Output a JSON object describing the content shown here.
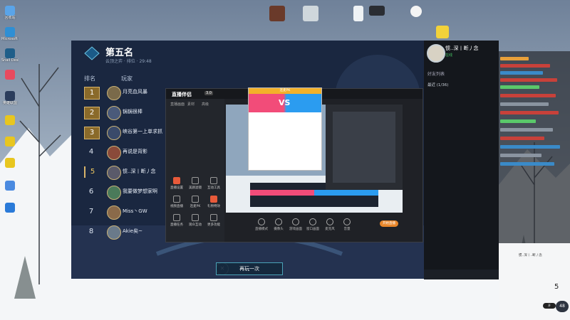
{
  "desktop": {
    "left_icons": [
      {
        "label": "回收站",
        "color": "#5aa4e8"
      },
      {
        "label": "Microsoft Edge",
        "color": "#2f8fd4"
      },
      {
        "label": "Snail Desktop",
        "color": "#1f5e89"
      },
      {
        "label": "",
        "color": "#e84a5f"
      },
      {
        "label": "英雄联盟",
        "color": "#2b3d5c"
      },
      {
        "label": "",
        "color": "#e8c61f"
      },
      {
        "label": "",
        "color": "#e8c61f"
      },
      {
        "label": "",
        "color": "#e8c61f"
      },
      {
        "label": "",
        "color": "#4a8ae0"
      },
      {
        "label": "",
        "color": "#2a7ad8"
      }
    ]
  },
  "game": {
    "title": "第五名",
    "subtitle": "云顶之弈 · 排位 · 29:48",
    "col_rank": "排名",
    "col_player": "玩家",
    "play_again": "再玩一次",
    "close_symbol": "✕",
    "rankings": [
      {
        "rank": "1",
        "name": "月亮血风暴",
        "medal": true,
        "self": false,
        "avatar": "#7a6a4a"
      },
      {
        "rank": "2",
        "name": "锅锅很棒",
        "medal": true,
        "self": false,
        "avatar": "#4a5a7a"
      },
      {
        "rank": "3",
        "name": "峡谷第一上单求抓",
        "medal": true,
        "self": false,
        "avatar": "#3a4a6a"
      },
      {
        "rank": "4",
        "name": "再说是背影",
        "medal": false,
        "self": false,
        "avatar": "#8a4a3a"
      },
      {
        "rank": "5",
        "name": "惯..深丨断丿念",
        "medal": false,
        "self": true,
        "avatar": "#5a5a6a"
      },
      {
        "rank": "6",
        "name": "我要做梦想家啊",
        "medal": false,
        "self": false,
        "avatar": "#4a7a5a"
      },
      {
        "rank": "7",
        "name": "Miss丶GW",
        "medal": false,
        "self": false,
        "avatar": "#8a6a4a"
      },
      {
        "rank": "8",
        "name": "Akie矣~",
        "medal": false,
        "self": false,
        "avatar": "#6a7a8a"
      }
    ]
  },
  "stream": {
    "app_name": "直播伴侣",
    "badge": "3.0",
    "side_tabs": [
      "直播画面",
      "素材",
      "高级"
    ],
    "tools": [
      {
        "label": "直播设置",
        "red": true
      },
      {
        "label": "美颜滤镜",
        "red": false
      },
      {
        "label": "互动工具",
        "red": false
      },
      {
        "label": "视频直播",
        "red": false
      },
      {
        "label": "连麦PK",
        "red": false
      },
      {
        "label": "礼物特效",
        "red": true
      },
      {
        "label": "直播任务",
        "red": false
      },
      {
        "label": "观众互动",
        "red": false
      },
      {
        "label": "更多功能",
        "red": false
      }
    ],
    "toolbar": [
      "直播模式",
      "摄像头",
      "游戏画面",
      "窗口画面",
      "麦克风",
      "音量"
    ],
    "start_label": "开始直播"
  },
  "vs_popup": {
    "header": "连麦PK",
    "vs": "VS"
  },
  "friends": {
    "name": "惯..深丨断丿念",
    "status": "在线",
    "list_title": "好友列表",
    "group": "最近 (1/36)"
  },
  "viewers": {
    "name": "惯..深丨..断丿念",
    "count": "5",
    "toggle": "开"
  },
  "timer": "48"
}
